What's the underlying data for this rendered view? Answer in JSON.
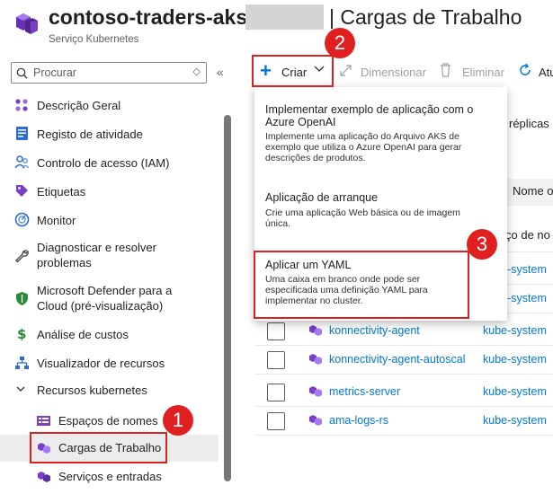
{
  "header": {
    "title": "contoso-traders-aks",
    "title_suffix": "| Cargas de Trabalho",
    "subtitle": "Serviço Kubernetes"
  },
  "search": {
    "placeholder": "Procurar",
    "collapse": "«",
    "updown": "◇"
  },
  "sidebar": {
    "items": [
      {
        "label": "Descrição Geral",
        "icon": "overview-icon"
      },
      {
        "label": "Registo de atividade",
        "icon": "activity-log-icon"
      },
      {
        "label": "Controlo de acesso (IAM)",
        "icon": "iam-icon"
      },
      {
        "label": "Etiquetas",
        "icon": "tag-icon"
      },
      {
        "label": "Monitor",
        "icon": "monitor-icon"
      },
      {
        "label": "Diagnosticar e resolver",
        "label2": "problemas",
        "icon": "wrench-icon"
      },
      {
        "label": "Microsoft Defender para a",
        "label2": "Cloud (pré-visualização)",
        "icon": "shield-icon"
      },
      {
        "label": "Análise de custos",
        "icon": "cost-icon"
      },
      {
        "label": "Visualizador de recursos",
        "icon": "resource-visualizer-icon"
      },
      {
        "label": "Recursos kubernetes",
        "icon": "chevron-down-icon"
      }
    ],
    "subitems": [
      {
        "label": "Espaços de nomes",
        "icon": "namespace-icon"
      },
      {
        "label": "Cargas de Trabalho",
        "icon": "workload-icon",
        "selected": true
      },
      {
        "label": "Serviços e entradas",
        "icon": "services-icon"
      }
    ]
  },
  "toolbar": {
    "create": "Criar",
    "resize": "Dimensionar",
    "delete": "Eliminar",
    "refresh": "Atu"
  },
  "dropdown": {
    "items": [
      {
        "title_l1": "Implementar exemplo de aplicação com o",
        "title_l2": "Azure OpenAI",
        "desc": [
          "Implemente uma aplicação do Arquivo AKS de",
          "exemplo que utiliza o Azure OpenAI para gerar",
          "descrições de produtos."
        ]
      },
      {
        "title_l1": "Aplicação de arranque",
        "desc": [
          "Crie uma aplicação Web básica ou de imagem",
          "única."
        ]
      },
      {
        "title_l1": "Aplicar um YAML",
        "desc": [
          "Uma caixa em branco onde pode ser",
          "especificada uma definição YAML para",
          "implementar no cluster."
        ]
      }
    ]
  },
  "table": {
    "replicas_fragment": "réplicas",
    "col_name_fragment": "Nome o",
    "col_ns_fragment": "ço de no",
    "rows": [
      {
        "name": "",
        "namespace": "kube-system"
      },
      {
        "name": "",
        "namespace": "kube-system"
      },
      {
        "name": "konnectivity-agent",
        "namespace": "kube-system"
      },
      {
        "name": "konnectivity-agent-autoscal",
        "namespace": "kube-system"
      },
      {
        "name": "metrics-server",
        "namespace": "kube-system"
      },
      {
        "name": "ama-logs-rs",
        "namespace": "kube-system"
      }
    ]
  },
  "callouts": [
    "1",
    "2",
    "3"
  ],
  "colors": {
    "accent": "#0078d4",
    "callout": "#e02020",
    "brand_purple": "#7a3fc5"
  }
}
